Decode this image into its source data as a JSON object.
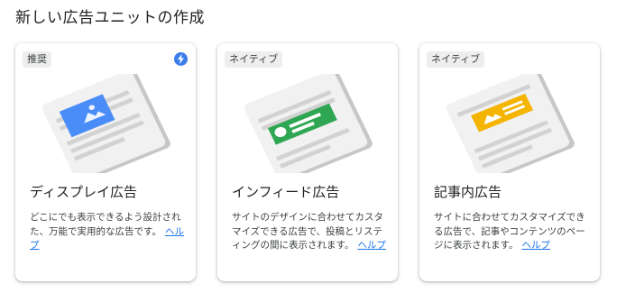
{
  "page": {
    "title": "新しい広告ユニットの作成"
  },
  "cards": [
    {
      "badge": "推奨",
      "badge_icon": "lightning-bolt-icon",
      "title": "ディスプレイ広告",
      "description": "どこにでも表示できるよう設計された、万能で実用的な広告です。",
      "help_label": "ヘルプ",
      "accent_color": "#4b8df8"
    },
    {
      "badge": "ネイティブ",
      "title": "インフィード広告",
      "description": "サイトのデザインに合わせてカスタマイズできる広告で、投稿とリスティングの間に表示されます。",
      "help_label": "ヘルプ",
      "accent_color": "#2fa752"
    },
    {
      "badge": "ネイティブ",
      "title": "記事内広告",
      "description": "サイトに合わせてカスタマイズできる広告で、記事やコンテンツのページに表示されます。",
      "help_label": "ヘルプ",
      "accent_color": "#f4b400"
    }
  ]
}
